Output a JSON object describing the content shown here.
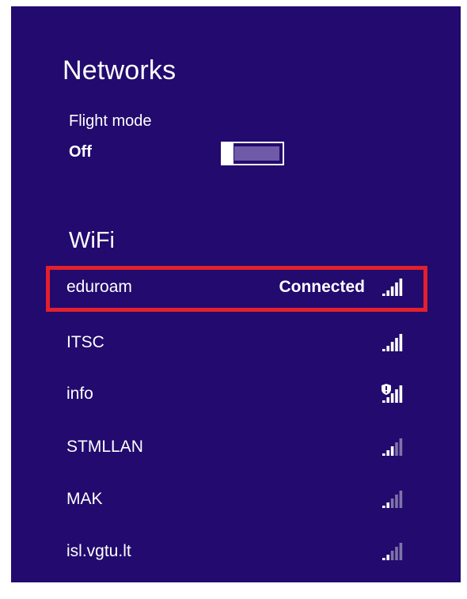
{
  "panel": {
    "title": "Networks"
  },
  "flight_mode": {
    "label": "Flight mode",
    "state": "Off",
    "on": false
  },
  "wifi": {
    "heading": "WiFi",
    "networks": [
      {
        "name": "eduroam",
        "status": "Connected",
        "signal_bars": 5,
        "secured_warning": false,
        "highlighted": true
      },
      {
        "name": "ITSC",
        "status": "",
        "signal_bars": 5,
        "secured_warning": false,
        "highlighted": false
      },
      {
        "name": "info",
        "status": "",
        "signal_bars": 5,
        "secured_warning": true,
        "highlighted": false
      },
      {
        "name": "STMLLAN",
        "status": "",
        "signal_bars": 3,
        "secured_warning": false,
        "highlighted": false
      },
      {
        "name": "MAK",
        "status": "",
        "signal_bars": 2,
        "secured_warning": false,
        "highlighted": false
      },
      {
        "name": "isl.vgtu.lt",
        "status": "",
        "signal_bars": 2,
        "secured_warning": false,
        "highlighted": false
      }
    ]
  },
  "colors": {
    "panel_background": "#220a6e",
    "highlight_border": "#e3202c",
    "signal_active": "#ffffff",
    "signal_inactive": "#7f74a8"
  },
  "icons": {
    "signal": "wifi-signal-icon",
    "warning": "shield-warning-icon"
  }
}
